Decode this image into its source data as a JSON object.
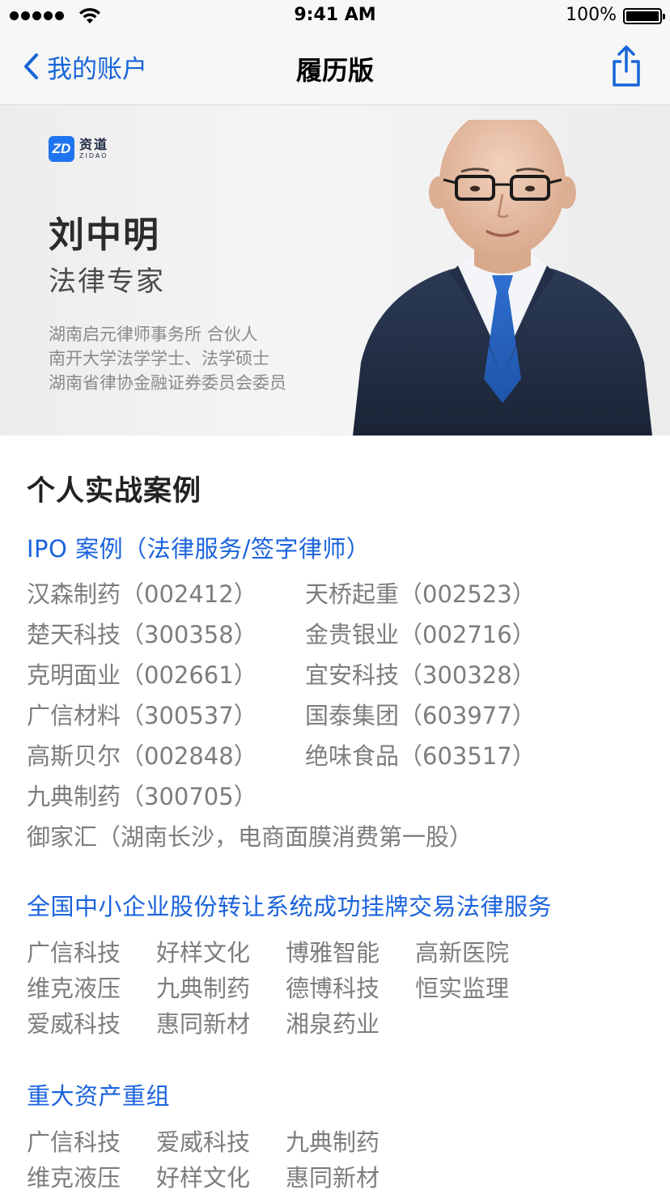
{
  "status_bar": {
    "time": "9:41 AM",
    "battery": "100%"
  },
  "nav": {
    "back_label": "我的账户",
    "title": "履历版"
  },
  "profile": {
    "brand_cn": "资道",
    "brand_en": "ZIDAO",
    "brand_mark": "ZD",
    "name": "刘中明",
    "title": "法律专家",
    "credentials": [
      "湖南启元律师事务所 合伙人",
      "南开大学法学学士、法学硕士",
      "湖南省律协金融证券委员会委员"
    ]
  },
  "section_title": "个人实战案例",
  "ipo": {
    "heading": "IPO 案例（法律服务/签字律师）",
    "rows": [
      [
        "汉森制药（002412）",
        "天桥起重（002523）"
      ],
      [
        "楚天科技（300358）",
        "金贵银业（002716）"
      ],
      [
        "克明面业（002661）",
        "宜安科技（300328）"
      ],
      [
        "广信材料（300537）",
        "国泰集团（603977）"
      ],
      [
        "高斯贝尔（002848）",
        "绝味食品（603517）"
      ],
      [
        "九典制药（300705）",
        ""
      ]
    ],
    "note": "御家汇（湖南长沙，电商面膜消费第一股）"
  },
  "neeq": {
    "heading": "全国中小企业股份转让系统成功挂牌交易法律服务",
    "rows": [
      [
        "广信科技",
        "好样文化",
        "博雅智能",
        "高新医院"
      ],
      [
        "维克液压",
        "九典制药",
        "德博科技",
        "恒实监理"
      ],
      [
        "爱威科技",
        "惠同新材",
        "湘泉药业",
        ""
      ]
    ]
  },
  "restructuring": {
    "heading": "重大资产重组",
    "rows": [
      [
        "广信科技",
        "爱威科技",
        "九典制药"
      ],
      [
        "维克液压",
        "好样文化",
        "惠同新材"
      ]
    ]
  },
  "colors": {
    "accent": "#1765d8",
    "heading_blue": "#1a63dd",
    "muted_text": "#7d7d7d"
  }
}
